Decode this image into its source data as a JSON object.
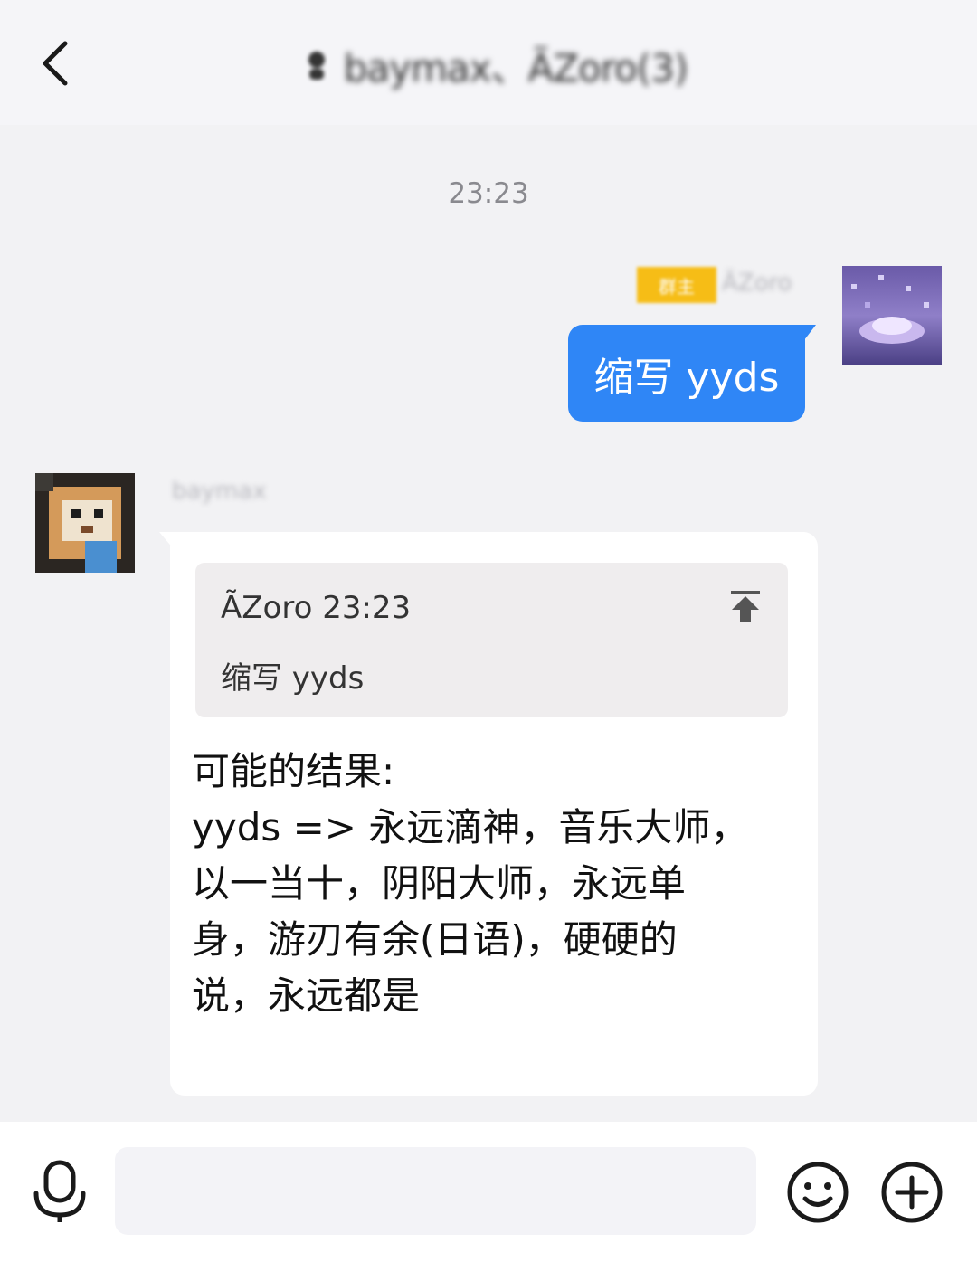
{
  "header": {
    "title": "baymax、ÃZoro(3)",
    "back_icon": "chevron-left-icon",
    "title_icon": "group-icon"
  },
  "timestamp": "23:23",
  "outgoing": {
    "badge": "群主",
    "sender": "ÃZoro",
    "text": "缩写 yyds",
    "bubble_color": "#2f86f6"
  },
  "incoming": {
    "sender": "baymax",
    "quote": {
      "meta": "ÃZoro 23:23",
      "text": "缩写 yyds",
      "jump_icon": "jump-to-top-icon"
    },
    "text": "可能的结果:\nyyds => 永远滴神，音乐大师，\n以一当十，阴阳大师，永远单\n身，游刃有余(日语)，硬硬的\n说，永远都是"
  },
  "input_bar": {
    "mic_icon": "microphone-icon",
    "emoji_icon": "emoji-icon",
    "plus_icon": "plus-icon",
    "input_value": ""
  },
  "colors": {
    "background": "#f2f2f4",
    "accent": "#2f86f6",
    "badge": "#f6bd16"
  }
}
